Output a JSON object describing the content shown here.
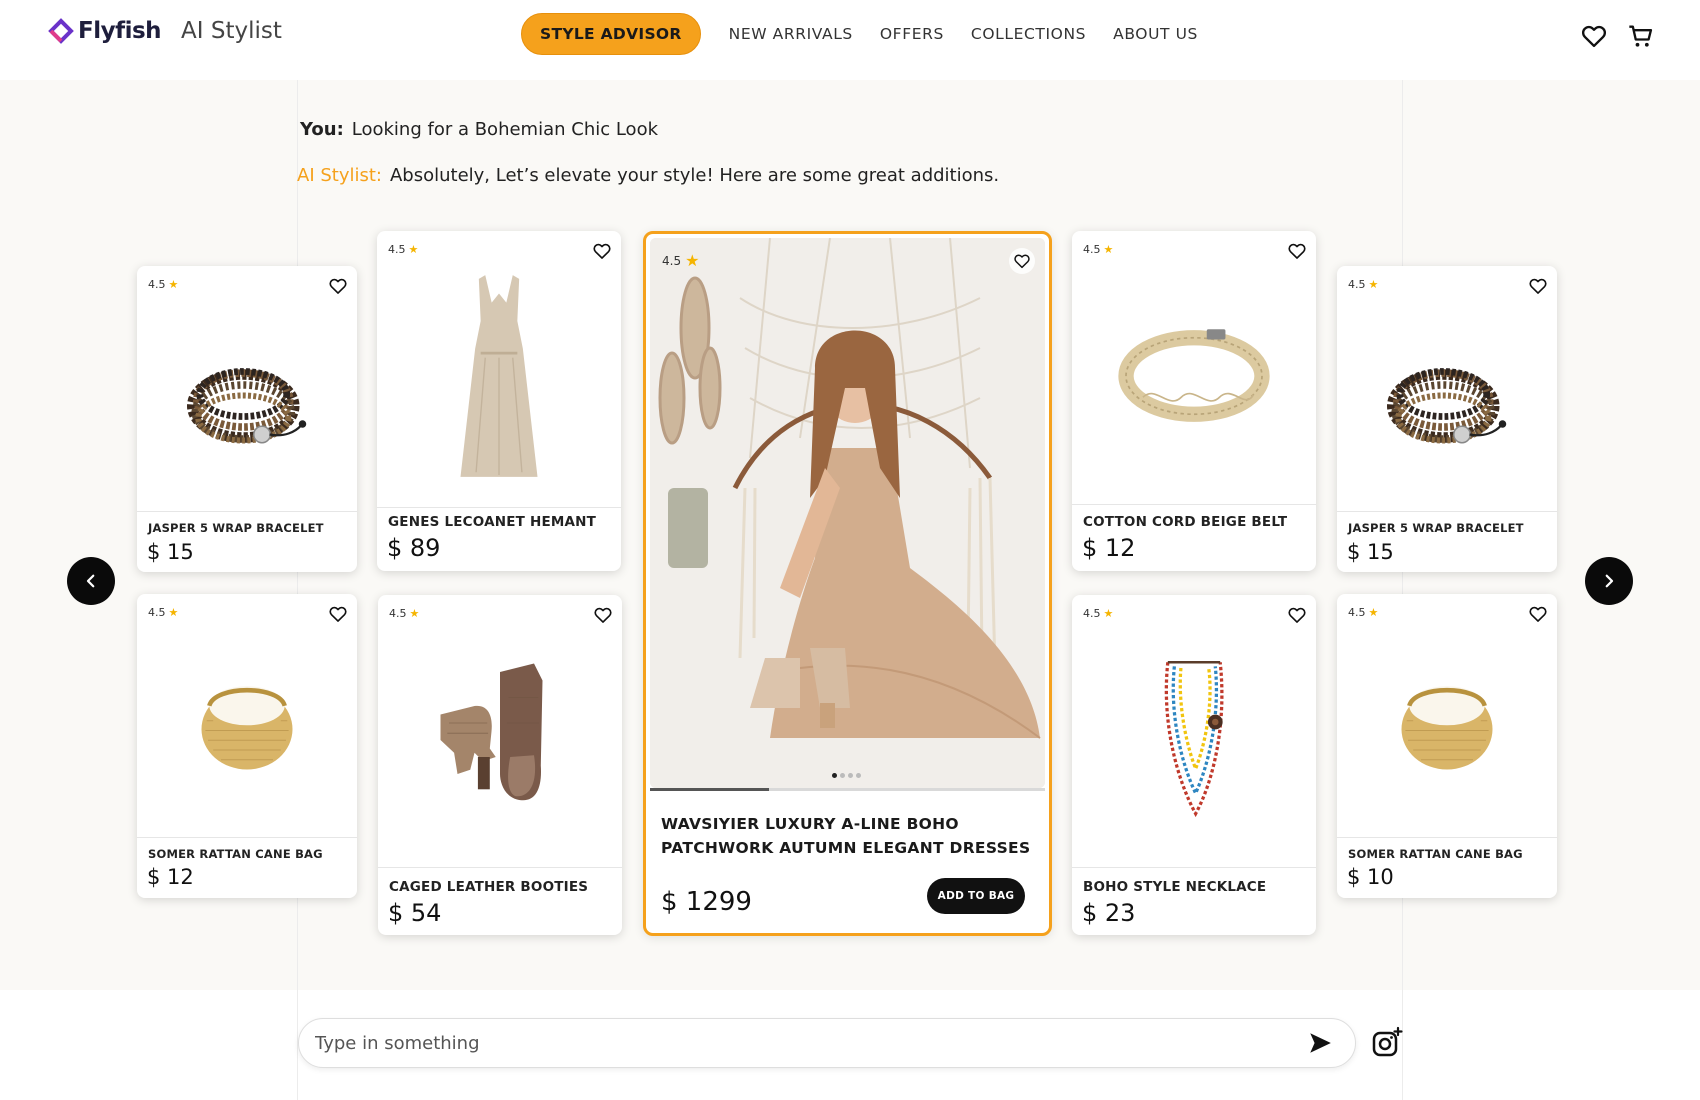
{
  "brand": {
    "name": "Flyfish",
    "subtitle": "AI Stylist",
    "accent": "#f5a11c"
  },
  "nav": {
    "active": "STYLE ADVISOR",
    "links": [
      "NEW ARRIVALS",
      "OFFERS",
      "COLLECTIONS",
      "ABOUT US"
    ]
  },
  "header_icons": [
    "heart-icon",
    "cart-icon"
  ],
  "chat": {
    "you_label": "You:",
    "you_text": "Looking for a Bohemian Chic Look",
    "ai_label": "AI Stylist:",
    "ai_text": "Absolutely, Let’s elevate your style! Here are some great additions."
  },
  "products": [
    {
      "name": "JASPER 5 WRAP BRACELET",
      "price": "$ 15",
      "rating": "4.5",
      "image": "bracelet-image"
    },
    {
      "name": "SOMER RATTAN CANE BAG",
      "price": "$ 12",
      "rating": "4.5",
      "image": "rattan-bag-image"
    },
    {
      "name": "GENES LECOANET HEMANT",
      "price": "$ 89",
      "rating": "4.5",
      "image": "dress-image"
    },
    {
      "name": "CAGED LEATHER BOOTIES",
      "price": "$ 54",
      "rating": "4.5",
      "image": "booties-image"
    },
    {
      "name": "COTTON CORD BEIGE BELT",
      "price": "$ 12",
      "rating": "4.5",
      "image": "belt-image"
    },
    {
      "name": "BOHO STYLE NECKLACE",
      "price": "$ 23",
      "rating": "4.5",
      "image": "necklace-image"
    },
    {
      "name": "JASPER 5 WRAP BRACELET",
      "price": "$ 15",
      "rating": "4.5",
      "image": "bracelet-image"
    },
    {
      "name": "SOMER RATTAN CANE BAG",
      "price": "$ 10",
      "rating": "4.5",
      "image": "rattan-bag-image"
    }
  ],
  "featured": {
    "name": "WAVSIYIER LUXURY A-LINE BOHO PATCHWORK AUTUMN ELEGANT DRESSES",
    "price": "$ 1299",
    "rating": "4.5",
    "button": "ADD TO BAG",
    "image_progress": 0.3,
    "slide_count": 4,
    "active_slide": 1
  },
  "input": {
    "placeholder": "Type in something"
  }
}
